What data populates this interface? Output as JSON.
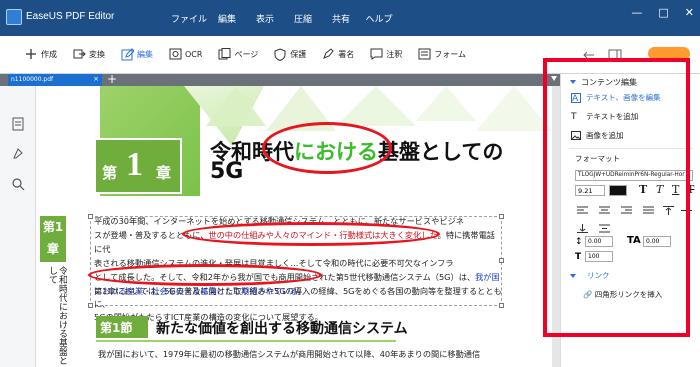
{
  "app": {
    "title": "EaseUS PDF Editor"
  },
  "menu": [
    "ファイル",
    "編集",
    "表示",
    "圧縮",
    "共有",
    "ヘルプ"
  ],
  "window_controls": {
    "minimize": "—",
    "maximize": "□",
    "close": "✕"
  },
  "toolbar": {
    "tools": [
      {
        "label": "作成",
        "icon": "plus-square-icon"
      },
      {
        "label": "変換",
        "icon": "convert-icon"
      },
      {
        "label": "編集",
        "icon": "edit-icon"
      },
      {
        "label": "OCR",
        "icon": "ocr-icon"
      },
      {
        "label": "ページ",
        "icon": "pages-icon"
      },
      {
        "label": "保護",
        "icon": "shield-icon"
      },
      {
        "label": "署名",
        "icon": "pen-icon"
      },
      {
        "label": "注釈",
        "icon": "comment-icon"
      },
      {
        "label": "フォーム",
        "icon": "form-icon"
      }
    ],
    "active_tool": "編集"
  },
  "tab": {
    "filename": "n1100000.pdf",
    "close": "×",
    "add": "+"
  },
  "document": {
    "chapter": {
      "dai": "第",
      "num": "1",
      "sho": "章"
    },
    "title_pre": "令和時代",
    "title_highlight": "における",
    "title_post": "基盤としての",
    "title_line2": "5G",
    "side_box": "第1章",
    "side_vertical": "令和時代における基盤として",
    "para_line1": "平成の30年間、インターネットを始めとする移動通信システム…とともに、新たなサービスやビジネ",
    "para_line2_pre": "スが登場・普及するとともに、",
    "para_line2_red": "世の中の仕組みや人々のマインド・行動様式は大きく変化した",
    "para_line2_post": "。特に携帯電話に代",
    "para_line3": "表される移動通信システムの進化・発展は目覚ましく…そして令和の時代に必要不可欠なインフラ",
    "para_line4_pre": "として成長した。そして、令和2年から我が国でも商用開始された第5世代移動通信システム（5G）は、",
    "para_line4_blue": "我が国",
    "para_line5_blue": "における産業・社会を支える基盤として期待されている。",
    "para2_line1": "第1章においては、5Gの普及に向けた取り組みや5Gの導入の経緯、5Gをめぐる各国の動向等を整理するとともに、",
    "para2_line2": "5Gの開始がもたらすICT産業の構造の変化について展望する。",
    "section_box": "第1節",
    "section_title": "新たな価値を創出する移動通信システム",
    "para3_line1": "我が国において、1979年に最初の移動通信システムが商用開始されて以降、40年あまりの間に移動通信"
  },
  "right_panel": {
    "title": "コンテンツ編集",
    "items": [
      {
        "label": "テキスト、画像を編集",
        "active": true
      },
      {
        "label": "テキストを追加",
        "active": false
      },
      {
        "label": "画像を追加",
        "active": false
      }
    ],
    "format_label": "フォーマット",
    "font_name": "TLOGJW+UDReiminPr6N-Regular-Hor",
    "font_size": "9.21",
    "bold": "T",
    "italic": "T",
    "underline": "T",
    "strike": "T",
    "line_spacing": "0.00",
    "char_spacing": "0.00",
    "scale": "100",
    "link_title": "リンク",
    "link_item": "四角形リンクを挿入"
  },
  "colors": {
    "titlebar": "#1d4f86",
    "accent": "#2b6fd6",
    "green": "#6fae3c",
    "annotation_red": "#e8141e"
  }
}
